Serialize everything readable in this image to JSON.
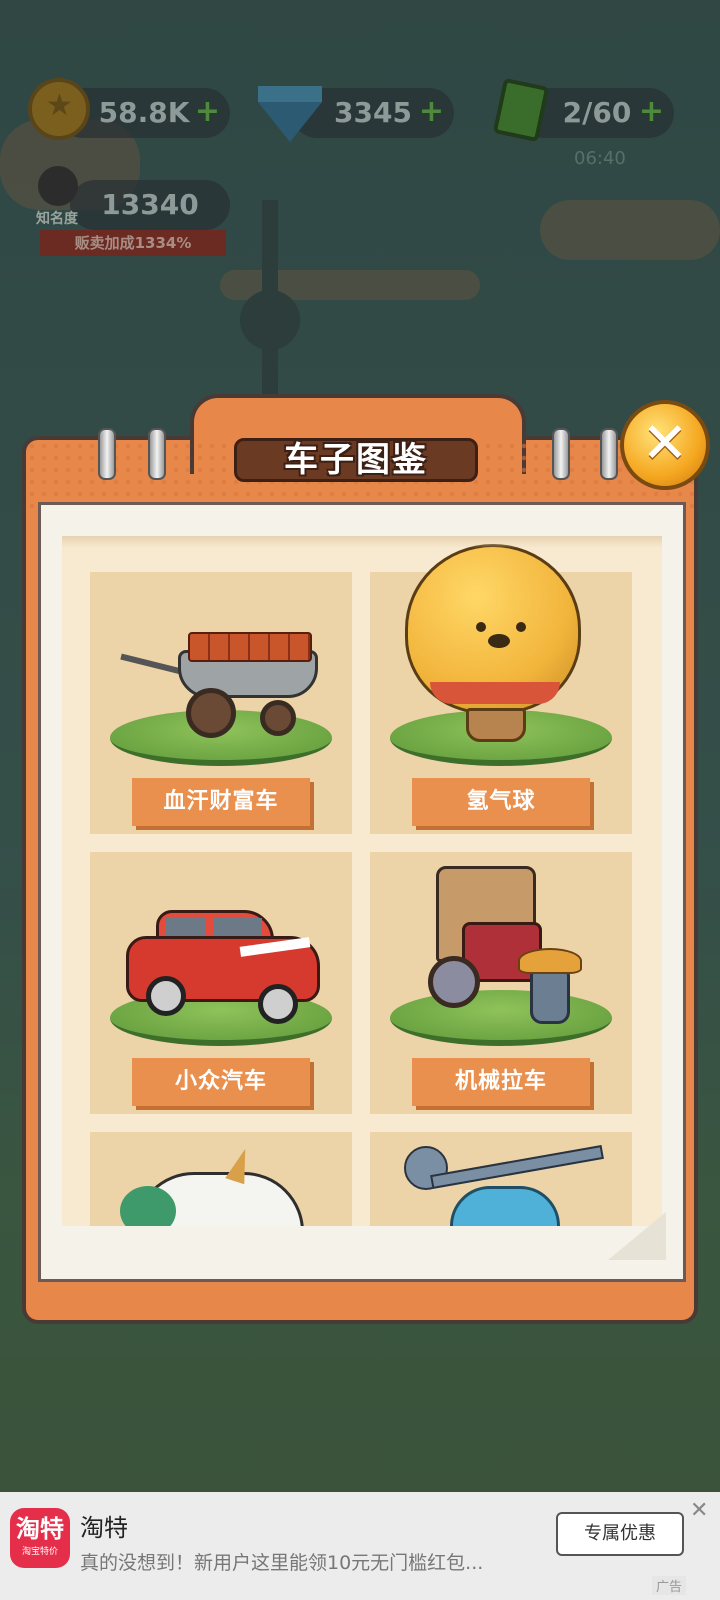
{
  "hud": {
    "coins": "58.8K",
    "gems": "3345",
    "energy": "2/60",
    "energy_timer": "06:40",
    "fame_label": "知名度",
    "fame_value": "13340",
    "sales_bonus": "贩卖加成1334%"
  },
  "dialog": {
    "title": "车子图鉴",
    "close_symbol": "✕",
    "items": [
      {
        "name": "血汗财富车",
        "icon": "wheelbarrow-icon"
      },
      {
        "name": "氢气球",
        "icon": "bear-balloon-icon"
      },
      {
        "name": "小众汽车",
        "icon": "red-car-icon"
      },
      {
        "name": "机械拉车",
        "icon": "rickshaw-robot-icon"
      },
      {
        "name": "",
        "icon": "unicorn-icon"
      },
      {
        "name": "",
        "icon": "helicopter-icon"
      }
    ]
  },
  "ad": {
    "brand": "淘特",
    "logo_text": "淘特",
    "logo_subtext": "淘宝特价",
    "description": "真的没想到！新用户这里能领10元无门槛红包...",
    "button_label": "专属优惠",
    "close_symbol": "✕",
    "tag": "广告"
  },
  "colors": {
    "panel_orange": "#e8874a",
    "label_orange": "#e9904f",
    "card_bg": "#ecd3a8",
    "close_gold": "#f5a720",
    "ad_brand_red": "#e52e4a"
  }
}
